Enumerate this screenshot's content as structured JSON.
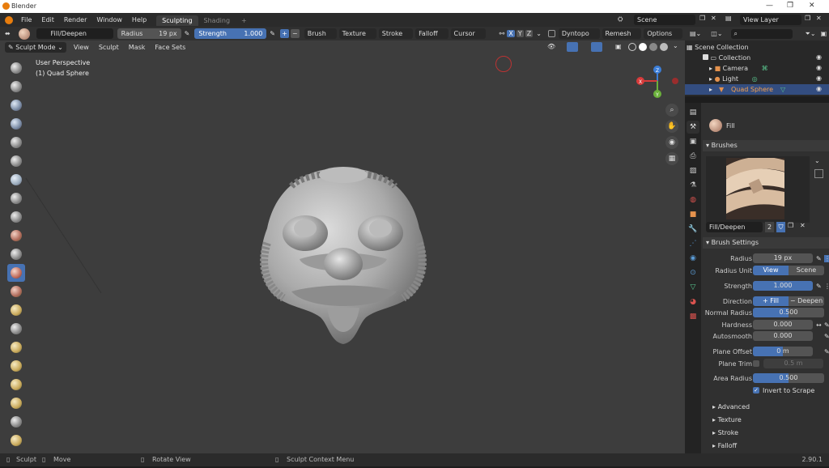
{
  "os": {
    "title": "Blender",
    "icon": "blender-logo-icon"
  },
  "menu": {
    "items": [
      "File",
      "Edit",
      "Render",
      "Window",
      "Help"
    ],
    "tabs": [
      "Sculpting",
      "Shading"
    ],
    "add": "+",
    "scene": "Scene",
    "view_layer": "View Layer"
  },
  "header": {
    "brush_name": "Fill/Deepen",
    "radius_label": "Radius",
    "radius_value": "19 px",
    "strength_label": "Strength",
    "strength_value": "1.000",
    "strength_fraction": 1.0,
    "menus": [
      "Brush",
      "Texture",
      "Stroke",
      "Falloff",
      "Cursor"
    ],
    "axes": [
      "X",
      "Y",
      "Z"
    ],
    "dyntopo": "Dyntopo",
    "remesh": "Remesh",
    "options": "Options"
  },
  "subheader": {
    "mode": "Sculpt Mode",
    "menus": [
      "View",
      "Sculpt",
      "Mask",
      "Face Sets"
    ]
  },
  "viewport": {
    "perspective": "User Perspective",
    "object": "(1) Quad Sphere",
    "accent": "#4772b3"
  },
  "gizmo": {
    "x": "X",
    "y": "Y",
    "z": "Z"
  },
  "outliner": {
    "search_placeholder": "",
    "root": "Scene Collection",
    "items": [
      {
        "label": "Collection"
      },
      {
        "label": "Camera"
      },
      {
        "label": "Light"
      },
      {
        "label": "Quad Sphere"
      }
    ]
  },
  "props": {
    "tool_name": "Fill",
    "brushes_title": "Brushes",
    "brush_field": "Fill/Deepen",
    "brush_users": "2",
    "settings_title": "Brush Settings",
    "radius": {
      "label": "Radius",
      "value": "19 px"
    },
    "radius_unit": {
      "label": "Radius Unit",
      "options": [
        "View",
        "Scene"
      ]
    },
    "strength": {
      "label": "Strength",
      "value": "1.000",
      "fraction": 1.0
    },
    "direction": {
      "label": "Direction",
      "options": [
        "Fill",
        "Deepen"
      ]
    },
    "normal_radius": {
      "label": "Normal Radius",
      "value": "0.500",
      "fraction": 0.5
    },
    "hardness": {
      "label": "Hardness",
      "value": "0.000"
    },
    "autosmooth": {
      "label": "Autosmooth",
      "value": "0.000"
    },
    "plane_offset": {
      "label": "Plane Offset",
      "value": "0 m"
    },
    "plane_trim": {
      "label": "Plane Trim",
      "value": "0.5 m"
    },
    "area_radius": {
      "label": "Area Radius",
      "value": "0.500",
      "fraction": 0.5
    },
    "invert": "Invert to Scrape",
    "collapsed": [
      "Advanced",
      "Texture",
      "Stroke",
      "Falloff"
    ]
  },
  "status": {
    "items": [
      "Sculpt",
      "Move",
      "Rotate View",
      "Sculpt Context Menu"
    ],
    "version": "2.90.1"
  }
}
